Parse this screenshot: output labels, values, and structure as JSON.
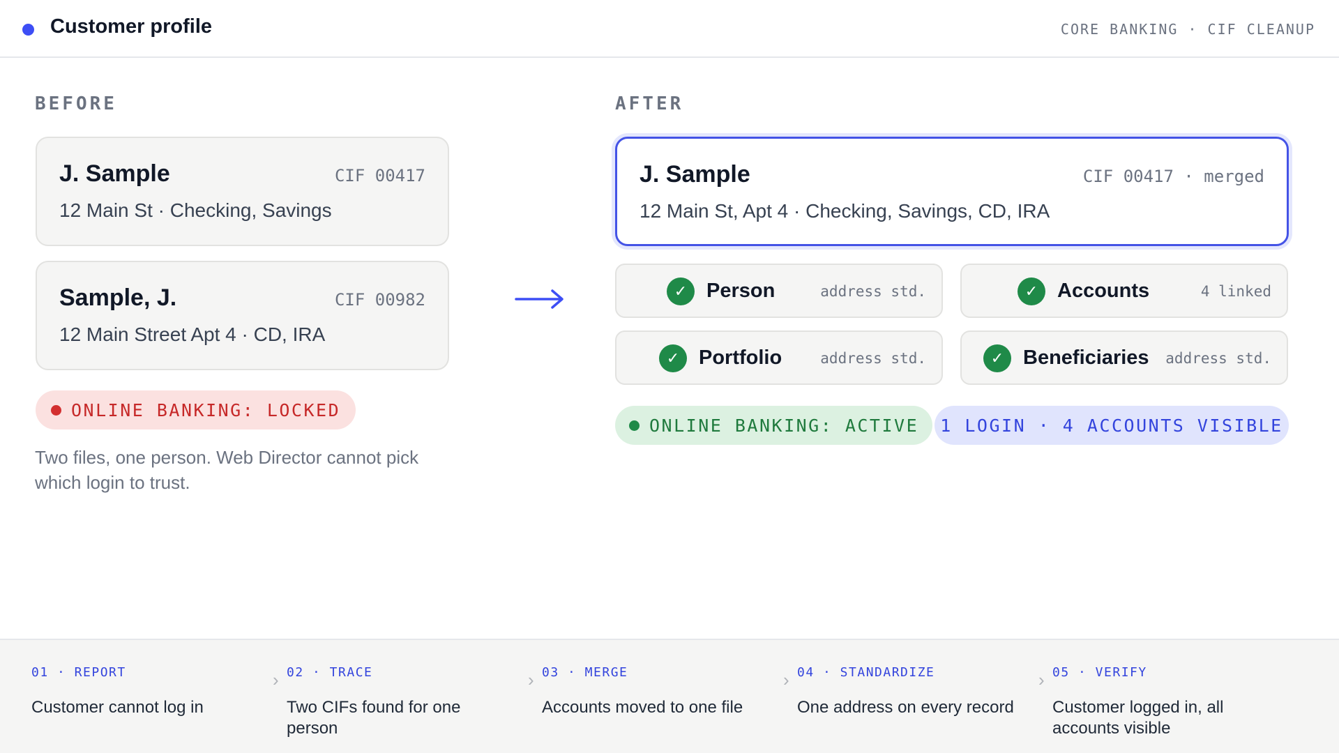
{
  "header": {
    "title": "Customer profile",
    "breadcrumb": "CORE BANKING · CIF CLEANUP"
  },
  "before": {
    "label": "BEFORE",
    "records": [
      {
        "name": "J. Sample",
        "cif": "CIF 00417",
        "details": "12 Main St · Checking, Savings"
      },
      {
        "name": "Sample, J.",
        "cif": "CIF 00982",
        "details": "12 Main Street Apt 4 · CD, IRA"
      }
    ],
    "status": "ONLINE BANKING: LOCKED",
    "note": "Two files, one person. Web Director cannot pick which login to trust."
  },
  "after": {
    "label": "AFTER",
    "record": {
      "name": "J. Sample",
      "cif": "CIF 00417 · merged",
      "details": "12 Main St, Apt 4 · Checking, Savings, CD, IRA"
    },
    "entities": [
      {
        "name": "Person",
        "meta": "address std."
      },
      {
        "name": "Accounts",
        "meta": "4 linked"
      },
      {
        "name": "Portfolio",
        "meta": "address std."
      },
      {
        "name": "Beneficiaries",
        "meta": "address std."
      }
    ],
    "status": "ONLINE BANKING: ACTIVE",
    "summary": "1 LOGIN · 4 ACCOUNTS VISIBLE",
    "check_glyph": "✓"
  },
  "steps": [
    {
      "label": "01 · REPORT",
      "text": "Customer cannot log in"
    },
    {
      "label": "02 · TRACE",
      "text": "Two CIFs found for one person"
    },
    {
      "label": "03 · MERGE",
      "text": "Accounts moved to one file"
    },
    {
      "label": "04 · STANDARDIZE",
      "text": "One address on every record"
    },
    {
      "label": "05 · VERIFY",
      "text": "Customer logged in, all accounts visible"
    }
  ],
  "colors": {
    "accent": "#3d4ef5",
    "success": "#1f8a48",
    "danger": "#d32f2f"
  }
}
